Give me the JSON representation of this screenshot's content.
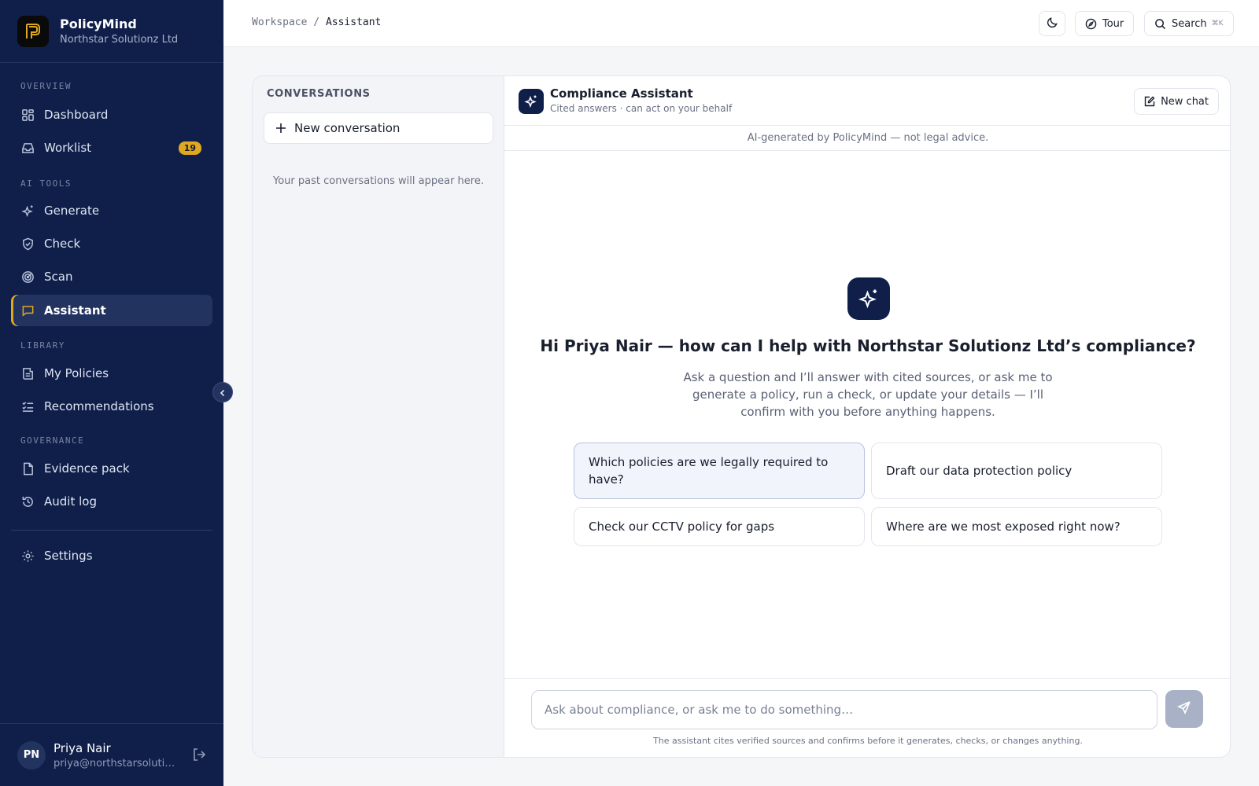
{
  "brand": {
    "name": "PolicyMind",
    "org": "Northstar Solutionz Ltd"
  },
  "sidebar": {
    "sections": [
      {
        "label": "OVERVIEW"
      },
      {
        "label": "AI TOOLS"
      },
      {
        "label": "LIBRARY"
      },
      {
        "label": "GOVERNANCE"
      }
    ],
    "items": [
      {
        "label": "Dashboard",
        "icon": "grid-icon"
      },
      {
        "label": "Worklist",
        "icon": "inbox-icon",
        "badge": "19"
      },
      {
        "label": "Generate",
        "icon": "sparkles-icon"
      },
      {
        "label": "Check",
        "icon": "shield-check-icon"
      },
      {
        "label": "Scan",
        "icon": "radar-icon"
      },
      {
        "label": "Assistant",
        "icon": "chat-icon",
        "active": true
      },
      {
        "label": "My Policies",
        "icon": "policies-icon"
      },
      {
        "label": "Recommendations",
        "icon": "checklist-icon"
      },
      {
        "label": "Evidence pack",
        "icon": "file-icon"
      },
      {
        "label": "Audit log",
        "icon": "history-icon"
      },
      {
        "label": "Settings",
        "icon": "gear-icon"
      }
    ],
    "user": {
      "initials": "PN",
      "name": "Priya Nair",
      "email": "priya@northstarsolutionz.co.uk"
    }
  },
  "topbar": {
    "breadcrumb_root": "Workspace",
    "breadcrumb_sep": "/",
    "breadcrumb_current": "Assistant",
    "tour_label": "Tour",
    "search_label": "Search",
    "search_shortcut": "⌘K"
  },
  "conversations": {
    "title": "CONVERSATIONS",
    "new_label": "New conversation",
    "empty_text": "Your past conversations will appear here."
  },
  "chat": {
    "assistant_name": "Compliance Assistant",
    "assistant_sub": "Cited answers · can act on your behalf",
    "new_chat_label": "New chat",
    "disclaimer": "AI-generated by PolicyMind — not legal advice.",
    "greeting": "Hi Priya Nair — how can I help with Northstar Solutionz Ltd’s compliance?",
    "intro": "Ask a question and I’ll answer with cited sources, or ask me to generate a policy, run a check, or update your details — I’ll confirm with you before anything happens.",
    "suggestions": [
      "Which policies are we legally required to have?",
      "Draft our data protection policy",
      "Check our CCTV policy for gaps",
      "Where are we most exposed right now?"
    ],
    "input_placeholder": "Ask about compliance, or ask me to do something…",
    "footer_note": "The assistant cites verified sources and confirms before it generates, checks, or changes anything."
  },
  "colors": {
    "sidebar": "#0f1f4a",
    "accent": "#e0a820",
    "send_disabled": "#a8b1c6"
  }
}
